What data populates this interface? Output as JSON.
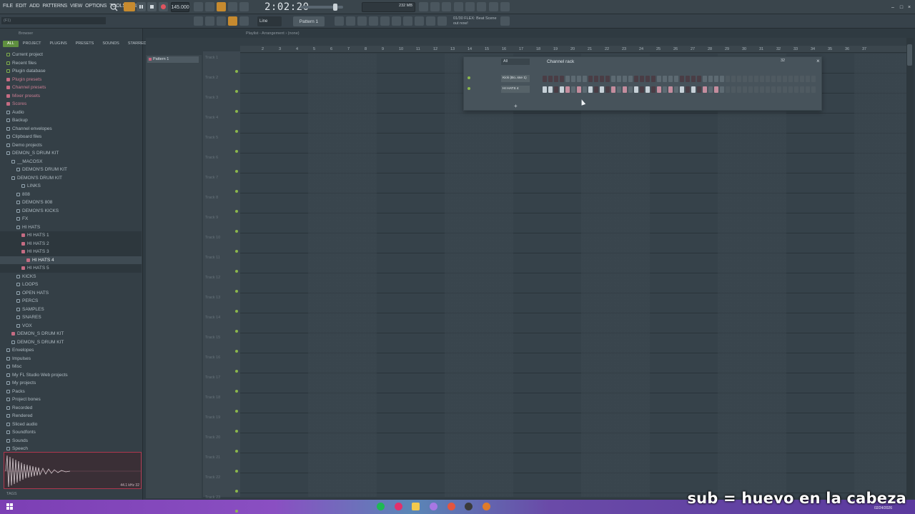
{
  "menu": [
    "FILE",
    "EDIT",
    "ADD",
    "PATTERNS",
    "VIEW",
    "OPTIONS",
    "TOOLS",
    "HELP"
  ],
  "transport": {
    "tempo": "145.000",
    "time": "2:02:20",
    "mode": "Line",
    "pattern": "Pattern 1",
    "memory": "232 MB"
  },
  "hint": {
    "line1": "01/30 FLEX: Beat Scene",
    "line2": "out now!"
  },
  "browser": {
    "title": "Browser",
    "search_placeholder": "(F1)",
    "tabs": [
      "ALL",
      "PROJECT",
      "PLUGINS",
      "PRESETS",
      "SOUNDS",
      "STARRED"
    ],
    "items": [
      {
        "label": "Current project",
        "indent": 0,
        "type": "green"
      },
      {
        "label": "Recent files",
        "indent": 0,
        "type": "green"
      },
      {
        "label": "Plugin database",
        "indent": 0,
        "type": "green"
      },
      {
        "label": "Plugin presets",
        "indent": 0,
        "type": "pink"
      },
      {
        "label": "Channel presets",
        "indent": 0,
        "type": "pink"
      },
      {
        "label": "Mixer presets",
        "indent": 0,
        "type": "pink"
      },
      {
        "label": "Scores",
        "indent": 0,
        "type": "pink"
      },
      {
        "label": "Audio",
        "indent": 0,
        "type": "folder"
      },
      {
        "label": "Backup",
        "indent": 0,
        "type": "folder"
      },
      {
        "label": "Channel envelopes",
        "indent": 0,
        "type": "folder"
      },
      {
        "label": "Clipboard files",
        "indent": 0,
        "type": "folder"
      },
      {
        "label": "Demo projects",
        "indent": 0,
        "type": "folder"
      },
      {
        "label": "DEMON_S DRUM KIT",
        "indent": 0,
        "type": "folder"
      },
      {
        "label": "__MACOSX",
        "indent": 1,
        "type": "folder"
      },
      {
        "label": "DEMON'S DRUM KIT",
        "indent": 2,
        "type": "folder"
      },
      {
        "label": "DEMON'S DRUM KIT",
        "indent": 1,
        "type": "folder"
      },
      {
        "label": "LINKS",
        "indent": 3,
        "type": "folder"
      },
      {
        "label": "808",
        "indent": 2,
        "type": "folder"
      },
      {
        "label": "DEMON'S 808",
        "indent": 2,
        "type": "folder"
      },
      {
        "label": "DEMON'S KICKS",
        "indent": 2,
        "type": "folder"
      },
      {
        "label": "FX",
        "indent": 2,
        "type": "folder"
      },
      {
        "label": "HI HATS",
        "indent": 2,
        "type": "folder"
      },
      {
        "label": "HI HATS 1",
        "indent": 3,
        "type": "pink"
      },
      {
        "label": "HI HATS 2",
        "indent": 3,
        "type": "pink"
      },
      {
        "label": "HI HATS 3",
        "indent": 3,
        "type": "pink"
      },
      {
        "label": "HI HATS 4",
        "indent": 4,
        "type": "pink",
        "sel": true
      },
      {
        "label": "HI HATS 5",
        "indent": 3,
        "type": "pink"
      },
      {
        "label": "KICKS",
        "indent": 2,
        "type": "folder"
      },
      {
        "label": "LOOPS",
        "indent": 2,
        "type": "folder"
      },
      {
        "label": "OPEN HATS",
        "indent": 2,
        "type": "folder"
      },
      {
        "label": "PERCS",
        "indent": 2,
        "type": "folder"
      },
      {
        "label": "SAMPLES",
        "indent": 2,
        "type": "folder"
      },
      {
        "label": "SNARES",
        "indent": 2,
        "type": "folder"
      },
      {
        "label": "VOX",
        "indent": 2,
        "type": "folder"
      },
      {
        "label": "DEMON_S DRUM KIT",
        "indent": 1,
        "type": "pink"
      },
      {
        "label": "DEMON_S DRUM KIT",
        "indent": 1,
        "type": "folder"
      },
      {
        "label": "Envelopes",
        "indent": 0,
        "type": "folder"
      },
      {
        "label": "Impulses",
        "indent": 0,
        "type": "folder"
      },
      {
        "label": "Misc",
        "indent": 0,
        "type": "folder"
      },
      {
        "label": "My FL Studio Web projects",
        "indent": 0,
        "type": "folder"
      },
      {
        "label": "My projects",
        "indent": 0,
        "type": "folder"
      },
      {
        "label": "Packs",
        "indent": 0,
        "type": "folder"
      },
      {
        "label": "Project bones",
        "indent": 0,
        "type": "folder"
      },
      {
        "label": "Recorded",
        "indent": 0,
        "type": "folder"
      },
      {
        "label": "Rendered",
        "indent": 0,
        "type": "folder"
      },
      {
        "label": "Sliced audio",
        "indent": 0,
        "type": "folder"
      },
      {
        "label": "Soundfonts",
        "indent": 0,
        "type": "folder"
      },
      {
        "label": "Sounds",
        "indent": 0,
        "type": "folder"
      },
      {
        "label": "Speech",
        "indent": 0,
        "type": "folder"
      }
    ],
    "sample_info": "44.1 kHz 32",
    "tags_label": "TAGS"
  },
  "playlist": {
    "header": "Playlist - Arrangement › (none)",
    "pattern_item": "Pattern 1",
    "tracks": [
      "Track 1",
      "Track 2",
      "Track 3",
      "Track 4",
      "Track 5",
      "Track 6",
      "Track 7",
      "Track 8",
      "Track 9",
      "Track 10",
      "Track 11",
      "Track 12",
      "Track 13",
      "Track 14",
      "Track 15",
      "Track 16",
      "Track 17",
      "Track 18",
      "Track 19",
      "Track 20",
      "Track 21",
      "Track 22",
      "Track 23"
    ],
    "ruler": [
      "2",
      "3",
      "4",
      "5",
      "6",
      "7",
      "8",
      "9",
      "10",
      "11",
      "12",
      "13",
      "14",
      "15",
      "16",
      "17",
      "18",
      "19",
      "20",
      "21",
      "22",
      "23",
      "24",
      "25",
      "26",
      "27",
      "28",
      "29",
      "30",
      "31",
      "32",
      "33",
      "34",
      "35",
      "36",
      "37"
    ]
  },
  "channel_rack": {
    "title": "Channel rack",
    "filter": "All",
    "swing": "32",
    "channels": [
      {
        "name": "Kick (Bo..sse 1)",
        "steps": [
          0,
          0,
          0,
          0,
          0,
          0,
          0,
          0,
          0,
          0,
          0,
          0,
          0,
          0,
          0,
          0,
          0,
          0,
          0,
          0,
          0,
          0,
          0,
          0,
          0,
          0,
          0,
          0,
          0,
          0,
          0,
          0
        ]
      },
      {
        "name": "HI HATS 4",
        "steps": [
          2,
          2,
          0,
          2,
          1,
          0,
          1,
          0,
          2,
          0,
          2,
          0,
          1,
          0,
          1,
          0,
          2,
          0,
          2,
          0,
          1,
          0,
          1,
          0,
          2,
          0,
          2,
          0,
          1,
          0,
          1,
          0
        ]
      }
    ]
  },
  "overlay": {
    "subtitle": "sub = huevo en la cabeza",
    "date": "02/24/2026"
  }
}
